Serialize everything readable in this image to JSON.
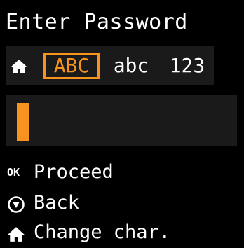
{
  "screen": {
    "title": "Enter Password"
  },
  "mode_bar": {
    "home_icon": "home-icon",
    "modes": [
      {
        "label": "ABC",
        "selected": true
      },
      {
        "label": "abc",
        "selected": false
      },
      {
        "label": "123",
        "selected": false
      }
    ]
  },
  "entry": {
    "value": "",
    "cursor_color": "#f7931e"
  },
  "options": {
    "proceed": {
      "icon_text": "OK",
      "label": "Proceed"
    },
    "back": {
      "icon": "stop-icon",
      "label": "Back"
    },
    "change": {
      "icon": "home-icon",
      "label": "Change char."
    }
  },
  "colors": {
    "accent": "#f7931e",
    "background": "#000000",
    "panel": "#1a1a1a",
    "text": "#ffffff"
  }
}
